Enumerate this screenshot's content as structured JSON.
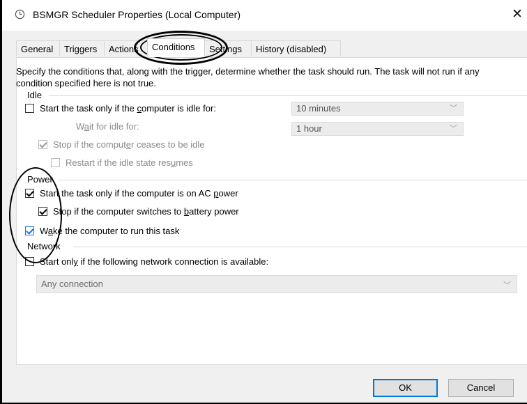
{
  "window": {
    "title": "BSMGR Scheduler Properties (Local Computer)",
    "close_glyph": "✕"
  },
  "tabs": [
    {
      "label": "General"
    },
    {
      "label": "Triggers"
    },
    {
      "label": "Actions"
    },
    {
      "label": "Conditions",
      "active": true
    },
    {
      "label": "Settings"
    },
    {
      "label": "History (disabled)"
    }
  ],
  "intro": "Specify the conditions that, along with the trigger, determine whether the task should run.  The task will not run  if any condition specified here is not true.",
  "idle": {
    "header": "Idle",
    "start_if_idle": {
      "pre": "Start the task only if the ",
      "key": "c",
      "post": "omputer is idle for:",
      "checked": false
    },
    "idle_for_value": "10 minutes",
    "wait_label": {
      "pre": "W",
      "key": "a",
      "post": "it for idle for:"
    },
    "wait_value": "1 hour",
    "stop_if_not_idle": {
      "pre": "Stop if the comput",
      "key": "e",
      "post": "r ceases to be idle",
      "checked": true
    },
    "restart_if_idle": {
      "pre": "Restart if the idle state res",
      "key": "u",
      "post": "mes",
      "checked": false
    }
  },
  "power": {
    "header": "Power",
    "ac_power": {
      "pre": "Start the task only if the computer is on AC ",
      "key": "p",
      "post": "ower",
      "checked": true
    },
    "battery": {
      "pre": "Stop if the computer switches to ",
      "key": "b",
      "post": "attery power",
      "checked": true
    },
    "wake": {
      "pre": "W",
      "key": "a",
      "post": "ke the computer to run this task",
      "checked": true
    }
  },
  "network": {
    "header": "Network",
    "start_only_if": {
      "pre": "Start onl",
      "key": "y",
      "post": " if the following network connection is available:",
      "checked": false
    },
    "connection_value": "Any connection"
  },
  "buttons": {
    "ok": "OK",
    "cancel": "Cancel"
  },
  "colors": {
    "accent": "#0078d7",
    "annotation": "#000000"
  }
}
